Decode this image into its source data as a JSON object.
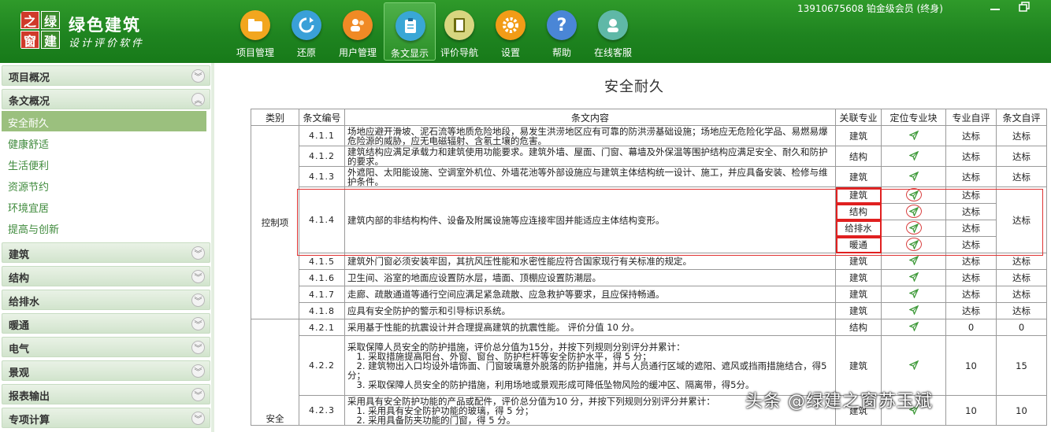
{
  "app": {
    "brand_name": "绿色建筑",
    "brand_sub": "设计评价软件",
    "logo_chars": [
      "之",
      "绿",
      "窗",
      "建"
    ],
    "account": "13910675608 铂金级会员 (终身)"
  },
  "colors": {
    "topbar": "#1f8420",
    "accent": "#9bc07e",
    "sidebar_link": "#3f8a3c",
    "highlight_red": "#e02020"
  },
  "toolbar": [
    {
      "label": "项目管理",
      "icon": "folder-icon",
      "color": "#f2a61e"
    },
    {
      "label": "还原",
      "icon": "restore-icon",
      "color": "#3aa0d8"
    },
    {
      "label": "用户管理",
      "icon": "users-icon",
      "color": "#f08a25"
    },
    {
      "label": "条文显示",
      "icon": "clipboard-icon",
      "color": "#39a7d6"
    },
    {
      "label": "评价导航",
      "icon": "book-icon",
      "color": "#9b9b1c"
    },
    {
      "label": "设置",
      "icon": "gear-icon",
      "color": "#f29c17"
    },
    {
      "label": "帮助",
      "icon": "help-icon",
      "color": "#4a86d6"
    },
    {
      "label": "在线客服",
      "icon": "support-icon",
      "color": "#5fb8a7"
    }
  ],
  "sidebar": {
    "sections_top": [
      {
        "label": "项目概况",
        "state": "collapsed"
      },
      {
        "label": "条文概况",
        "state": "expanded"
      }
    ],
    "sub_items": [
      "安全耐久",
      "健康舒适",
      "生活便利",
      "资源节约",
      "环境宜居",
      "提高与创新"
    ],
    "selected": "安全耐久",
    "sections_bottom": [
      "建筑",
      "结构",
      "给排水",
      "暖通",
      "电气",
      "景观",
      "报表输出",
      "专项计算"
    ]
  },
  "page_title": "安全耐久",
  "table": {
    "headers": [
      "类别",
      "条文编号",
      "条文内容",
      "关联专业",
      "定位专业块",
      "专业自评",
      "条文自评"
    ],
    "cat_control": "控制项",
    "cat_score": "安全",
    "rows": [
      {
        "id": "4.1.1",
        "content": "场地应避开滑坡、泥石流等地质危险地段，易发生洪涝地区应有可靠的防洪涝基础设施；场地应无危险化学品、易燃易爆危险源的威胁，应无电磁辐射、含氡土壤的危害。",
        "dept": "建筑",
        "self": "达标",
        "clause": "达标"
      },
      {
        "id": "4.1.2",
        "content": "建筑结构应满足承载力和建筑使用功能要求。建筑外墙、屋面、门窗、幕墙及外保温等围护结构应满足安全、耐久和防护的要求。",
        "dept": "结构",
        "self": "达标",
        "clause": "达标"
      },
      {
        "id": "4.1.3",
        "content": "外遮阳、太阳能设施、空调室外机位、外墙花池等外部设施应与建筑主体结构统一设计、施工，并应具备安装、检修与维护条件。",
        "dept": "建筑",
        "self": "达标",
        "clause": "达标"
      },
      {
        "id": "4.1.4",
        "content": "建筑内部的非结构构件、设备及附属设施等应连接牢固并能适应主体结构变形。",
        "depts": [
          "建筑",
          "结构",
          "给排水",
          "暖通"
        ],
        "selfs": [
          "达标",
          "达标",
          "达标",
          "达标"
        ],
        "clause": "达标"
      },
      {
        "id": "4.1.5",
        "content": "建筑外门窗必须安装牢固，其抗风压性能和水密性能应符合国家现行有关标准的规定。",
        "dept": "建筑",
        "self": "达标",
        "clause": "达标"
      },
      {
        "id": "4.1.6",
        "content": "卫生间、浴室的地面应设置防水层，墙面、顶棚应设置防潮层。",
        "dept": "建筑",
        "self": "达标",
        "clause": "达标"
      },
      {
        "id": "4.1.7",
        "content": "走廊、疏散通道等通行空间应满足紧急疏散、应急救护等要求，且应保持畅通。",
        "dept": "建筑",
        "self": "达标",
        "clause": "达标"
      },
      {
        "id": "4.1.8",
        "content": "应具有安全防护的警示和引导标识系统。",
        "dept": "建筑",
        "self": "达标",
        "clause": "达标"
      },
      {
        "id": "4.2.1",
        "content": "采用基于性能的抗震设计并合理提高建筑的抗震性能。 评价分值 10 分。",
        "dept": "结构",
        "self": "0",
        "clause": "0"
      },
      {
        "id": "4.2.2",
        "content_lines": [
          "采取保障人员安全的防护措施，评价总分值为15分，并按下列规则分别评分并累计：",
          "　1. 采取措施提高阳台、外窗、窗台、防护栏杆等安全防护水平，得 5 分；",
          "　2. 建筑物出入口均设外墙饰面、门窗玻璃意外脱落的防护措施，并与人员通行区域的遮阳、遮风或挡雨措施结合，得5分；",
          "　3. 采取保障人员安全的防护措施，利用场地或景观形成可降低坠物风险的缓冲区、隔离带，得5分。"
        ],
        "dept": "建筑",
        "self": "10",
        "clause": "15"
      },
      {
        "id": "4.2.3",
        "content_lines": [
          "采用具有安全防护功能的产品或配件，评价总分值为10 分，并按下列规则分别评分并累计：",
          "　1. 采用具有安全防护功能的玻璃，得 5 分；",
          "　2. 采用具备防夹功能的门窗，得 5 分。"
        ],
        "dept": "建筑",
        "self": "10",
        "clause": "10"
      }
    ]
  },
  "watermark": "头条 @绿建之窗苏玉斌"
}
